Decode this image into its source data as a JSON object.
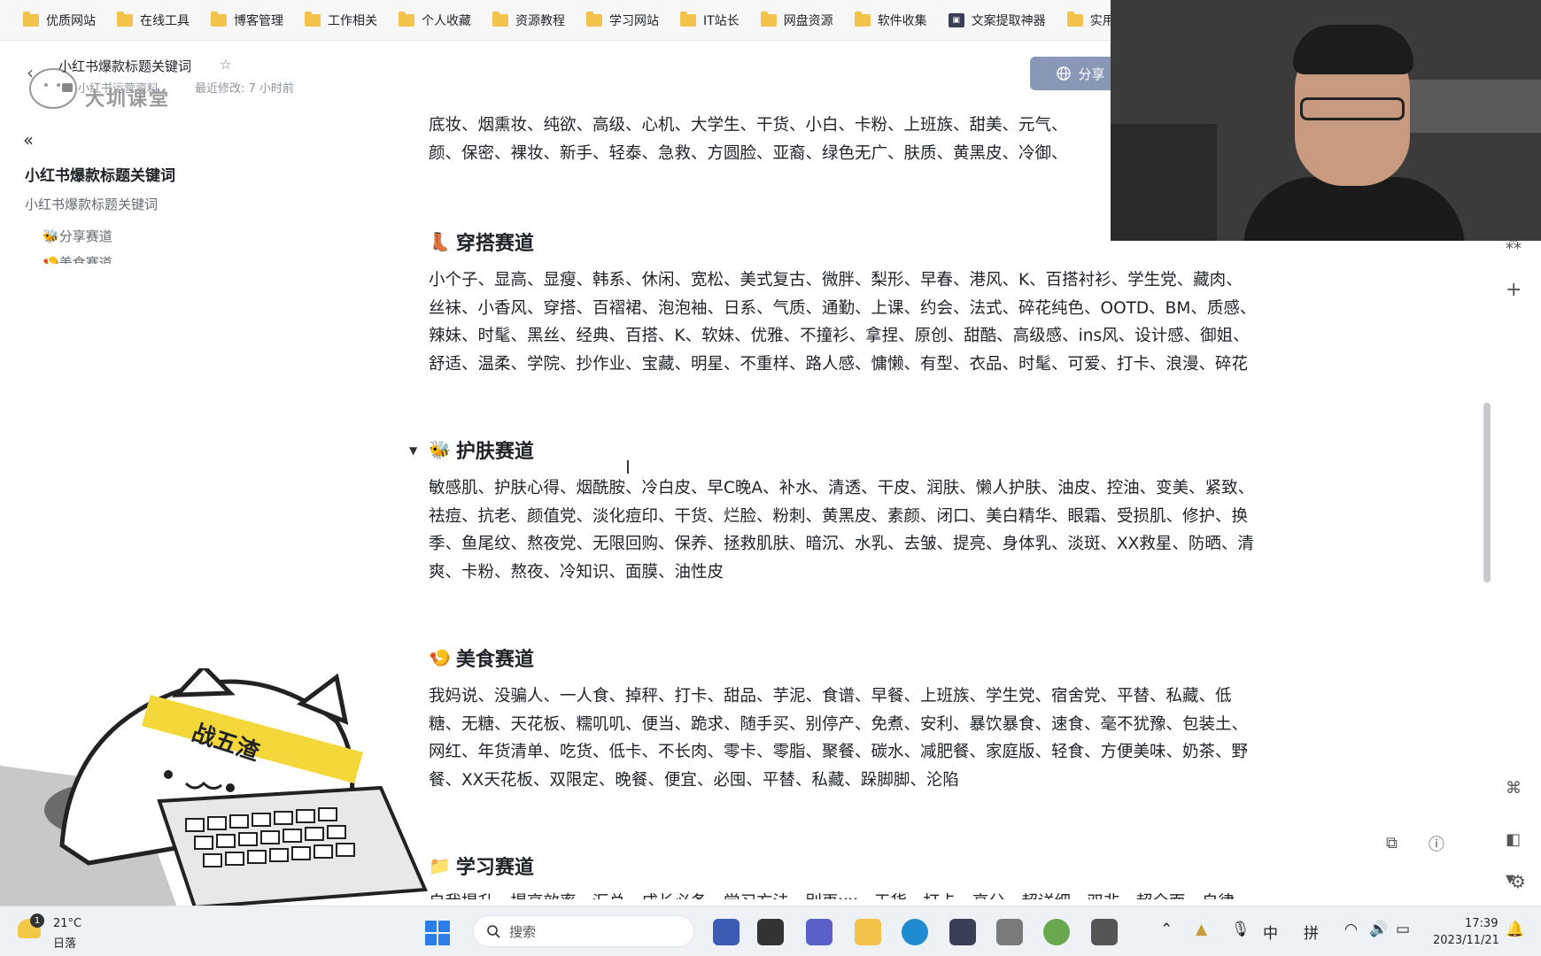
{
  "bookmarks": [
    {
      "label": "优质网站",
      "icon": "folder-icon"
    },
    {
      "label": "在线工具",
      "icon": "folder-icon"
    },
    {
      "label": "博客管理",
      "icon": "folder-icon"
    },
    {
      "label": "工作相关",
      "icon": "folder-icon"
    },
    {
      "label": "个人收藏",
      "icon": "folder-icon"
    },
    {
      "label": "资源教程",
      "icon": "folder-icon"
    },
    {
      "label": "学习网站",
      "icon": "folder-icon"
    },
    {
      "label": "IT站长",
      "icon": "folder-icon"
    },
    {
      "label": "网盘资源",
      "icon": "folder-icon"
    },
    {
      "label": "软件收集",
      "icon": "folder-icon"
    },
    {
      "label": "文案提取神器",
      "icon": "app-icon"
    },
    {
      "label": "实用",
      "icon": "folder-icon"
    }
  ],
  "header": {
    "logo_text": "大圳课堂",
    "doc_title": "小红书爆款标题关键词",
    "doc_path": "小红书运营资料",
    "modified": "最近修改: 7 小时前",
    "share_label": "分享"
  },
  "sidebar": {
    "title": "小红书爆款标题关键词",
    "subtitle": "小红书爆款标题关键词",
    "items": [
      "分享赛道",
      "美食赛道"
    ]
  },
  "content": {
    "intro_lines": [
      "底妆、烟熏妆、纯欲、高级、心机、大学生、干货、小白、卡粉、上班族、甜美、元气、",
      "颜、保密、裸妆、新手、轻泰、急救、方圆脸、亚裔、绿色无广、肤质、黄黑皮、冷御、"
    ],
    "sections": [
      {
        "title": "穿搭赛道",
        "emoji": "👢",
        "lines": [
          "小个子、显高、显瘦、韩系、休闲、宽松、美式复古、微胖、梨形、早春、港风、K、百搭衬衫、学生党、藏肉、",
          "丝袜、小香风、穿搭、百褶裙、泡泡袖、日系、气质、通勤、上课、约会、法式、碎花纯色、OOTD、BM、质感、",
          "辣妹、时髦、黑丝、经典、百搭、K、软妹、优雅、不撞衫、拿捏、原创、甜酷、高级感、ins风、设计感、御姐、",
          "舒适、温柔、学院、抄作业、宝藏、明星、不重样、路人感、慵懒、有型、衣品、时髦、可爱、打卡、浪漫、碎花"
        ]
      },
      {
        "title": "护肤赛道",
        "emoji": "🐝",
        "lines": [
          "敏感肌、护肤心得、烟酰胺、冷白皮、早C晚A、补水、清透、干皮、润肤、懒人护肤、油皮、控油、变美、紧致、",
          "祛痘、抗老、颜值党、淡化痘印、干货、烂脸、粉刺、黄黑皮、素颜、闭口、美白精华、眼霜、受损肌、修护、换",
          "季、鱼尾纹、熬夜党、无限回购、保养、拯救肌肤、暗沉、水乳、去皱、提亮、身体乳、淡斑、XX救星、防晒、清",
          "爽、卡粉、熬夜、冷知识、面膜、油性皮"
        ]
      },
      {
        "title": "美食赛道",
        "emoji": "🍤",
        "lines": [
          "我妈说、没骗人、一人食、掉秤、打卡、甜品、芋泥、食谱、早餐、上班族、学生党、宿舍党、平替、私藏、低",
          "糖、无糖、天花板、糯叽叽、便当、跪求、随手买、别停产、免煮、安利、暴饮暴食、速食、毫不犹豫、包装土、",
          "网红、年货清单、吃货、低卡、不长肉、零卡、零脂、聚餐、碳水、减肥餐、家庭版、轻食、方便美味、奶茶、野",
          "餐、XX天花板、双限定、晚餐、便宜、必囤、平替、私藏、跺脚脚、沦陷"
        ]
      },
      {
        "title": "学习赛道",
        "emoji": "📁",
        "lines": [
          "自我提升、提高效率、汇总、成长必备、学习方法、别再xx、干货、打卡、高分、超详细、双非、超全面、自律"
        ]
      }
    ]
  },
  "sticker": {
    "headband_text": "战五渣"
  },
  "taskbar": {
    "weather_badge": "1",
    "temperature": "21°C",
    "condition": "日落",
    "search_placeholder": "搜索",
    "ime_mode": "中",
    "ime_name": "拼",
    "time": "17:39",
    "date": "2023/11/21"
  },
  "colors": {
    "accent": "#8a98b8",
    "folder": "#f3c34b",
    "start": "#2b7de9"
  }
}
